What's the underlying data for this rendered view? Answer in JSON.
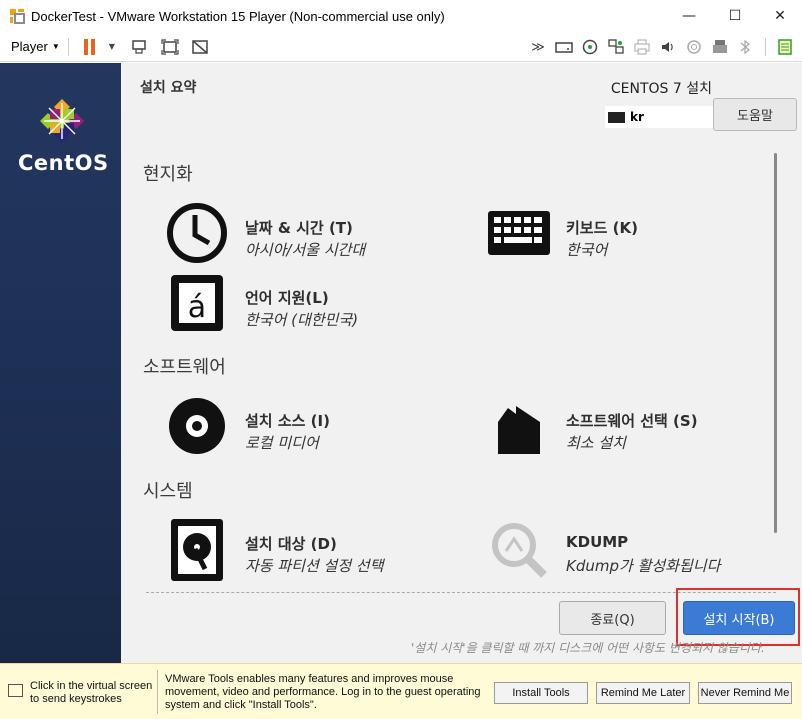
{
  "window": {
    "title": "DockerTest - VMware Workstation 15 Player (Non-commercial use only)",
    "controls": {
      "minimize": "—",
      "maximize": "☐",
      "close": "✕"
    }
  },
  "toolbar": {
    "player_label": "Player",
    "left_icons": [
      "pause-icon",
      "send-ctrl-alt-del-icon",
      "fit-guest-icon",
      "unity-icon"
    ],
    "right_icons": [
      "chevron-double-right-icon",
      "hard-disk-icon",
      "cd-icon",
      "network-icon",
      "printer-icon",
      "sound-icon",
      "camera-icon",
      "usb-printer-icon",
      "bluetooth-icon",
      "message-icon"
    ]
  },
  "installer": {
    "summary_title": "설치 요약",
    "install_title": "CENTOS 7 설치",
    "keyboard_layout": "kr",
    "help_label": "도움말",
    "logo_text": "CentOS",
    "sections": {
      "localization": "현지화",
      "software": "소프트웨어",
      "system": "시스템"
    },
    "spokes": {
      "datetime": {
        "title": "날짜 & 시간 (T)",
        "status": "아시아/서울 시간대"
      },
      "keyboard": {
        "title": "키보드 (K)",
        "status": "한국어"
      },
      "language": {
        "title": "언어 지원(L)",
        "status": "한국어 (대한민국)"
      },
      "source": {
        "title": "설치 소스 (I)",
        "status": "로컬 미디어"
      },
      "software": {
        "title": "소프트웨어 선택 (S)",
        "status": "최소 설치"
      },
      "destination": {
        "title": "설치 대상 (D)",
        "status": "자동 파티션 설정 선택"
      },
      "kdump": {
        "title": "KDUMP",
        "status": "Kdump가 활성화됩니다"
      }
    },
    "quit_label": "종료(Q)",
    "begin_label": "설치 시작(B)",
    "hint": "'설치 시작'을 클릭할 때 까지 디스크에 어떤 사항도 변경되지 않습니다."
  },
  "notification": {
    "click_text": "Click in the virtual screen to send keystrokes",
    "tools_text": "VMware Tools enables many features and improves mouse movement, video and performance. Log in to the guest operating system and click \"Install Tools\".",
    "install_tools": "Install Tools",
    "remind_later": "Remind Me Later",
    "never_remind": "Never Remind Me"
  },
  "colors": {
    "accent_blue": "#3b7bd6",
    "sidebar": "#1f3158",
    "highlight_red": "#e0302e",
    "notify_bg": "#fffbd6"
  }
}
